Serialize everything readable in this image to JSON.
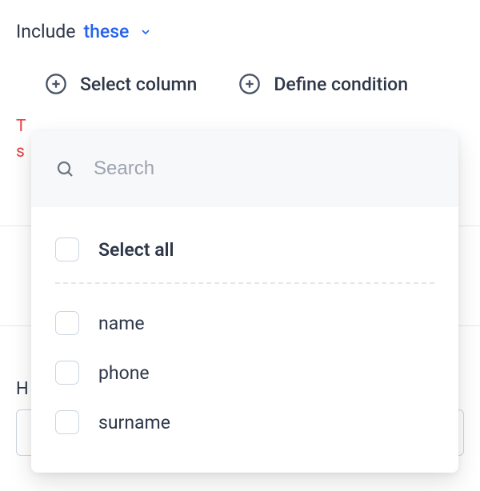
{
  "header": {
    "include_label": "Include",
    "these_label": "these"
  },
  "buttons": {
    "select_column": "Select column",
    "define_condition": "Define condition"
  },
  "error": {
    "line_partial_left": "T",
    "line_partial_second": "s"
  },
  "background": {
    "h_partial": "H"
  },
  "dropdown": {
    "search_placeholder": "Search",
    "select_all": "Select all",
    "options": [
      {
        "label": "name"
      },
      {
        "label": "phone"
      },
      {
        "label": "surname"
      }
    ]
  }
}
